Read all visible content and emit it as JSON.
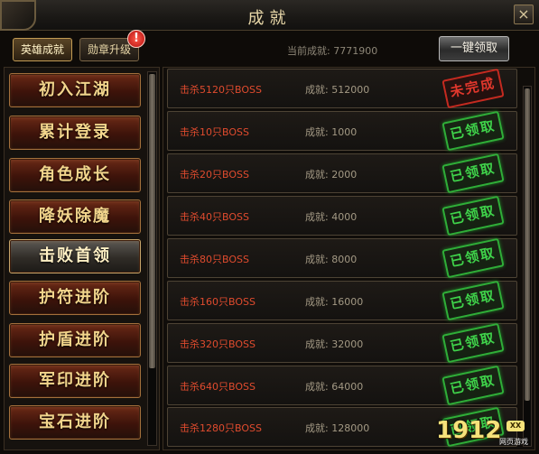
{
  "window": {
    "title": "成就",
    "close_label": "×"
  },
  "tabs": [
    {
      "label": "英雄成就",
      "active": true
    },
    {
      "label": "勋章升级",
      "active": false,
      "badge": "!"
    }
  ],
  "current_achievement": "当前成就: 7771900",
  "claim_all_label": "一键领取",
  "categories": [
    {
      "label": "初入江湖",
      "active": false
    },
    {
      "label": "累计登录",
      "active": false
    },
    {
      "label": "角色成长",
      "active": false
    },
    {
      "label": "降妖除魔",
      "active": false
    },
    {
      "label": "击败首领",
      "active": true
    },
    {
      "label": "护符进阶",
      "active": false
    },
    {
      "label": "护盾进阶",
      "active": false
    },
    {
      "label": "军印进阶",
      "active": false
    },
    {
      "label": "宝石进阶",
      "active": false
    }
  ],
  "achievements": [
    {
      "name": "击杀5120只BOSS",
      "points": "成就: 512000",
      "status": "未完成",
      "state": "incomplete"
    },
    {
      "name": "击杀10只BOSS",
      "points": "成就: 1000",
      "status": "已领取",
      "state": "claimed"
    },
    {
      "name": "击杀20只BOSS",
      "points": "成就: 2000",
      "status": "已领取",
      "state": "claimed"
    },
    {
      "name": "击杀40只BOSS",
      "points": "成就: 4000",
      "status": "已领取",
      "state": "claimed"
    },
    {
      "name": "击杀80只BOSS",
      "points": "成就: 8000",
      "status": "已领取",
      "state": "claimed"
    },
    {
      "name": "击杀160只BOSS",
      "points": "成就: 16000",
      "status": "已领取",
      "state": "claimed"
    },
    {
      "name": "击杀320只BOSS",
      "points": "成就: 32000",
      "status": "已领取",
      "state": "claimed"
    },
    {
      "name": "击杀640只BOSS",
      "points": "成就: 64000",
      "status": "已领取",
      "state": "claimed"
    },
    {
      "name": "击杀1280只BOSS",
      "points": "成就: 128000",
      "status": "已领取",
      "state": "claimed"
    }
  ],
  "watermark": {
    "number": "1912",
    "tag": "XX",
    "sub": "网页游戏"
  },
  "colors": {
    "claimed": "#3fd24a",
    "incomplete": "#e1372c",
    "achievement_name": "#e04b2e"
  }
}
